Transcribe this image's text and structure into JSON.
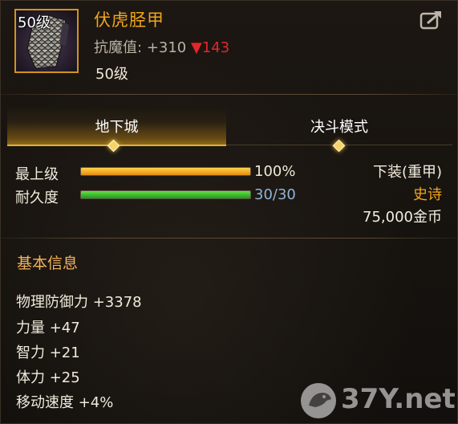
{
  "item": {
    "level_badge": "50级",
    "name": "伏虎胫甲",
    "stat_label": "抗魔值:",
    "stat_value": "+310",
    "stat_change": "▼143",
    "required_level": "50级"
  },
  "tabs": [
    {
      "label": "地下城",
      "active": true
    },
    {
      "label": "决斗模式",
      "active": false
    }
  ],
  "bars": [
    {
      "label": "最上级",
      "value_text": "100%",
      "fraction": 1.0,
      "color": "#f0a020"
    },
    {
      "label": "耐久度",
      "value_text": "30/30",
      "fraction": 1.0,
      "color": "#3cc030"
    }
  ],
  "right_info": {
    "slot": "下装(重甲)",
    "rarity": "史诗",
    "price": "75,000金币"
  },
  "basic_info": {
    "title": "基本信息",
    "attributes": [
      "物理防御力 +3378",
      "力量 +47",
      "智力 +21",
      "体力 +25",
      "移动速度 +4%"
    ]
  },
  "watermark": {
    "text": "37Y.net",
    "icon": "bird-logo-icon"
  },
  "icons": {
    "share": "share-icon",
    "item": "greave-armor-icon",
    "tab_marker": "diamond-icon"
  },
  "colors": {
    "accent_gold": "#f2a51b",
    "decrease_red": "#e3262a",
    "durability_blue": "#8fb3d9",
    "epic_orange": "#f2a51b",
    "section_title": "#f2b35a"
  }
}
